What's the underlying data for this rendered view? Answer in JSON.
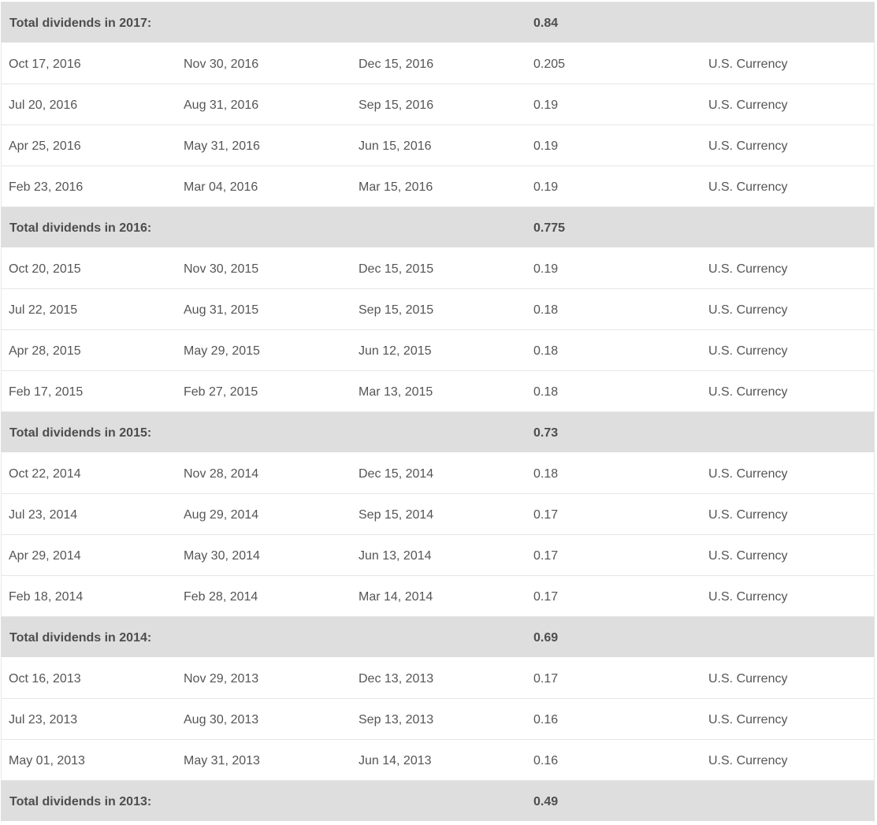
{
  "table": {
    "rows": [
      {
        "kind": "total",
        "label": "Total dividends in 2017:",
        "amount": "0.84"
      },
      {
        "kind": "row",
        "announced": "Oct 17, 2016",
        "record": "Nov 30, 2016",
        "payable": "Dec 15, 2016",
        "amount": "0.205",
        "currency": "U.S. Currency"
      },
      {
        "kind": "row",
        "announced": "Jul 20, 2016",
        "record": "Aug 31, 2016",
        "payable": "Sep 15, 2016",
        "amount": "0.19",
        "currency": "U.S. Currency"
      },
      {
        "kind": "row",
        "announced": "Apr 25, 2016",
        "record": "May 31, 2016",
        "payable": "Jun 15, 2016",
        "amount": "0.19",
        "currency": "U.S. Currency"
      },
      {
        "kind": "row",
        "announced": "Feb 23, 2016",
        "record": "Mar 04, 2016",
        "payable": "Mar 15, 2016",
        "amount": "0.19",
        "currency": "U.S. Currency"
      },
      {
        "kind": "total",
        "label": "Total dividends in 2016:",
        "amount": "0.775"
      },
      {
        "kind": "row",
        "announced": "Oct 20, 2015",
        "record": "Nov 30, 2015",
        "payable": "Dec 15, 2015",
        "amount": "0.19",
        "currency": "U.S. Currency"
      },
      {
        "kind": "row",
        "announced": "Jul 22, 2015",
        "record": "Aug 31, 2015",
        "payable": "Sep 15, 2015",
        "amount": "0.18",
        "currency": "U.S. Currency"
      },
      {
        "kind": "row",
        "announced": "Apr 28, 2015",
        "record": "May 29, 2015",
        "payable": "Jun 12, 2015",
        "amount": "0.18",
        "currency": "U.S. Currency"
      },
      {
        "kind": "row",
        "announced": "Feb 17, 2015",
        "record": "Feb 27, 2015",
        "payable": "Mar 13, 2015",
        "amount": "0.18",
        "currency": "U.S. Currency"
      },
      {
        "kind": "total",
        "label": "Total dividends in 2015:",
        "amount": "0.73"
      },
      {
        "kind": "row",
        "announced": "Oct 22, 2014",
        "record": "Nov 28, 2014",
        "payable": "Dec 15, 2014",
        "amount": "0.18",
        "currency": "U.S. Currency"
      },
      {
        "kind": "row",
        "announced": "Jul 23, 2014",
        "record": "Aug 29, 2014",
        "payable": "Sep 15, 2014",
        "amount": "0.17",
        "currency": "U.S. Currency"
      },
      {
        "kind": "row",
        "announced": "Apr 29, 2014",
        "record": "May 30, 2014",
        "payable": "Jun 13, 2014",
        "amount": "0.17",
        "currency": "U.S. Currency"
      },
      {
        "kind": "row",
        "announced": "Feb 18, 2014",
        "record": "Feb 28, 2014",
        "payable": "Mar 14, 2014",
        "amount": "0.17",
        "currency": "U.S. Currency"
      },
      {
        "kind": "total",
        "label": "Total dividends in 2014:",
        "amount": "0.69"
      },
      {
        "kind": "row",
        "announced": "Oct 16, 2013",
        "record": "Nov 29, 2013",
        "payable": "Dec 13, 2013",
        "amount": "0.17",
        "currency": "U.S. Currency"
      },
      {
        "kind": "row",
        "announced": "Jul 23, 2013",
        "record": "Aug 30, 2013",
        "payable": "Sep 13, 2013",
        "amount": "0.16",
        "currency": "U.S. Currency"
      },
      {
        "kind": "row",
        "announced": "May 01, 2013",
        "record": "May 31, 2013",
        "payable": "Jun 14, 2013",
        "amount": "0.16",
        "currency": "U.S. Currency"
      },
      {
        "kind": "total",
        "label": "Total dividends in 2013:",
        "amount": "0.49"
      }
    ]
  },
  "colors": {
    "total_row_background": "#dedede",
    "row_divider": "#e6e6e6",
    "text": "#555555"
  }
}
